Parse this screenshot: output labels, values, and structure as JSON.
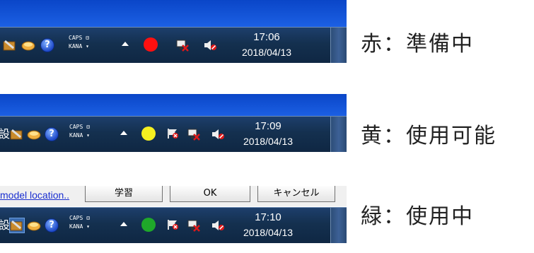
{
  "panels": [
    {
      "id": "red",
      "clock": {
        "time": "17:06",
        "date": "2018/04/13"
      },
      "caps": {
        "line1": "CAPS ⊟",
        "line2": "KANA ▾"
      },
      "status_dot_color": "#ff1010",
      "label": "赤：準備中",
      "show_flag": false,
      "show_kanji": false
    },
    {
      "id": "yellow",
      "clock": {
        "time": "17:09",
        "date": "2018/04/13"
      },
      "caps": {
        "line1": "CAPS ⊟",
        "line2": "KANA ▾"
      },
      "status_dot_color": "#f5f020",
      "label": "黄：使用可能",
      "show_flag": true,
      "show_kanji": true,
      "kanji": "設"
    },
    {
      "id": "green",
      "clock": {
        "time": "17:10",
        "date": "2018/04/13"
      },
      "caps": {
        "line1": "CAPS ⊟",
        "line2": "KANA ▾"
      },
      "status_dot_color": "#1fa82a",
      "label": "緑：使用中",
      "show_flag": true,
      "show_kanji": true,
      "kanji": "設"
    }
  ],
  "dialog": {
    "link_text": "model location..",
    "buttons": [
      "学習",
      "OK",
      "キャンセル"
    ]
  },
  "colors": {
    "taskbar": "#14304f",
    "desktop_blue": "#1450d8"
  }
}
